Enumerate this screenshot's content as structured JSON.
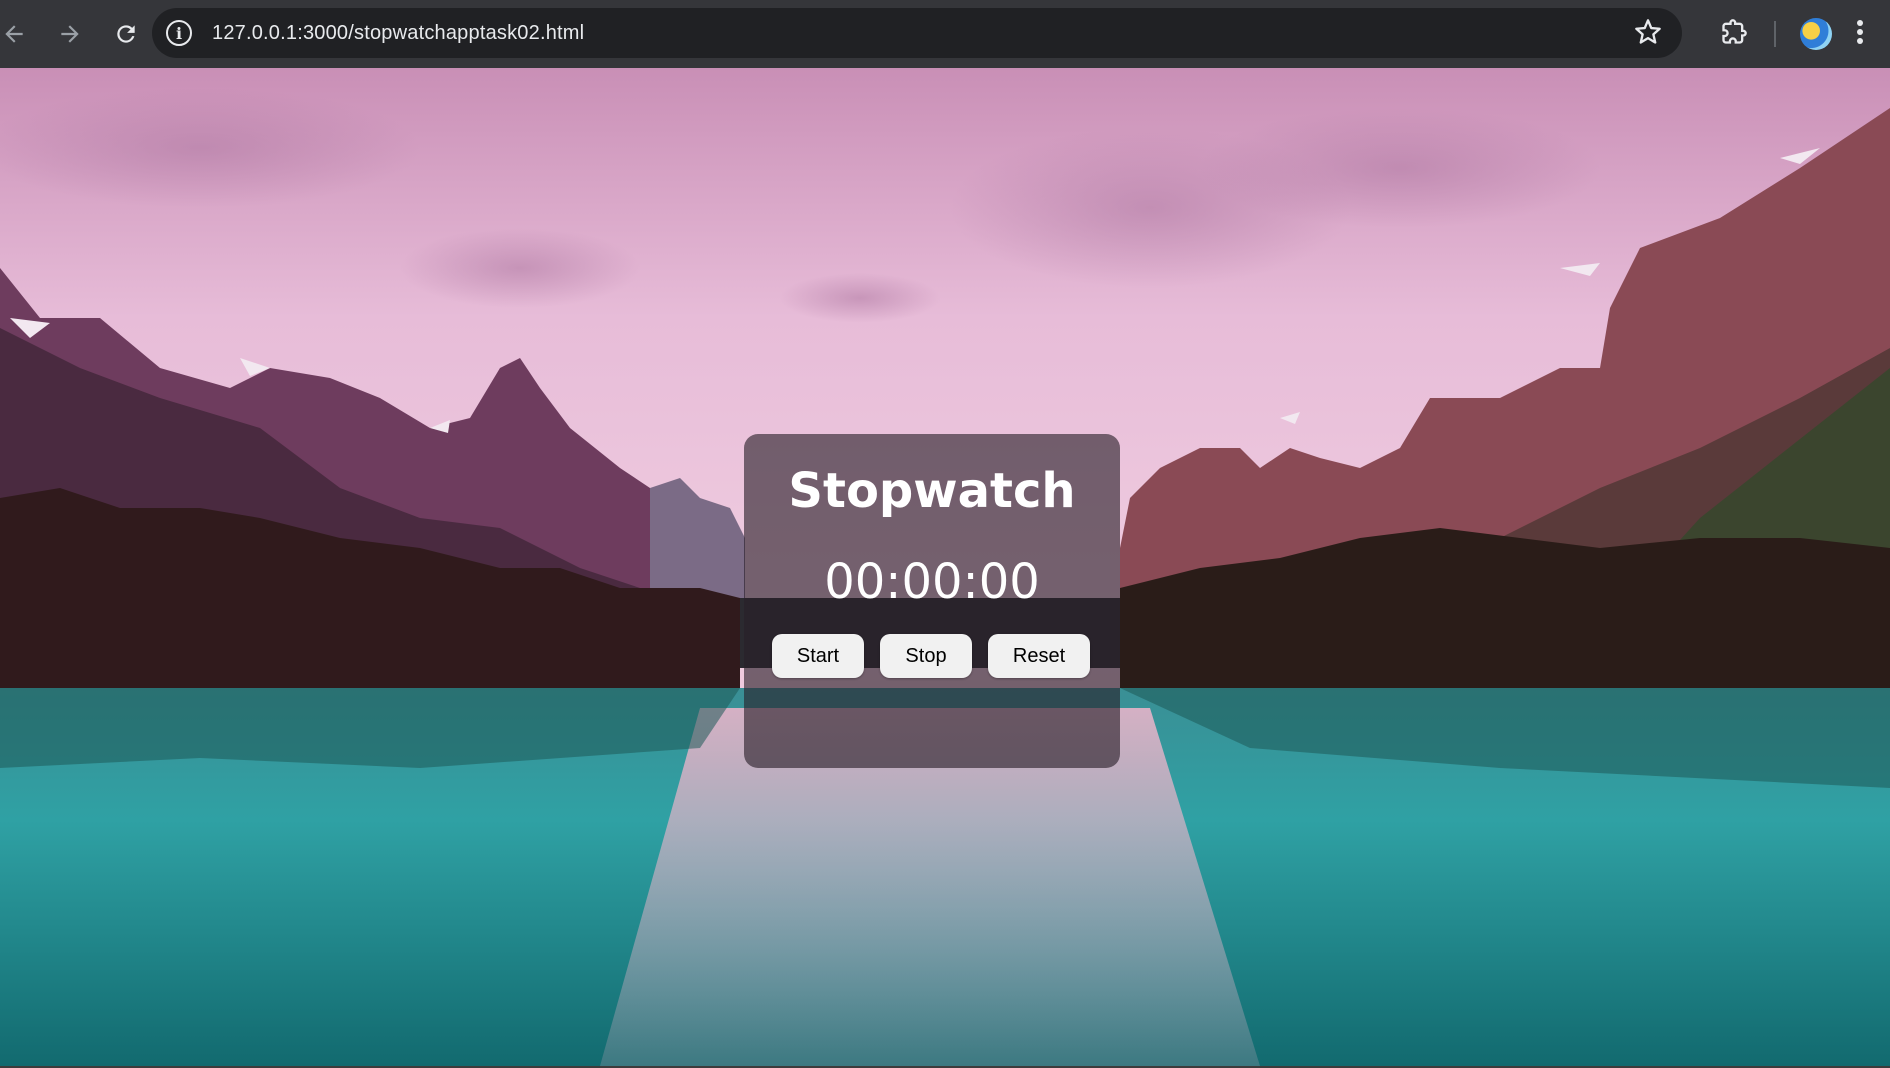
{
  "browser": {
    "url": "127.0.0.1:3000/stopwatchapptask02.html"
  },
  "app": {
    "title": "Stopwatch",
    "time": "00:00:00",
    "buttons": {
      "start": "Start",
      "stop": "Stop",
      "reset": "Reset"
    }
  },
  "colors": {
    "panel_bg": "#281e28",
    "button_bg": "#f1f1f1",
    "sky": "#e9b7d3",
    "water": "#2b9a9a"
  },
  "icons": [
    "back-icon",
    "forward-icon",
    "reload-icon",
    "info-icon",
    "star-icon",
    "extensions-icon",
    "avatar",
    "more-menu-icon"
  ]
}
